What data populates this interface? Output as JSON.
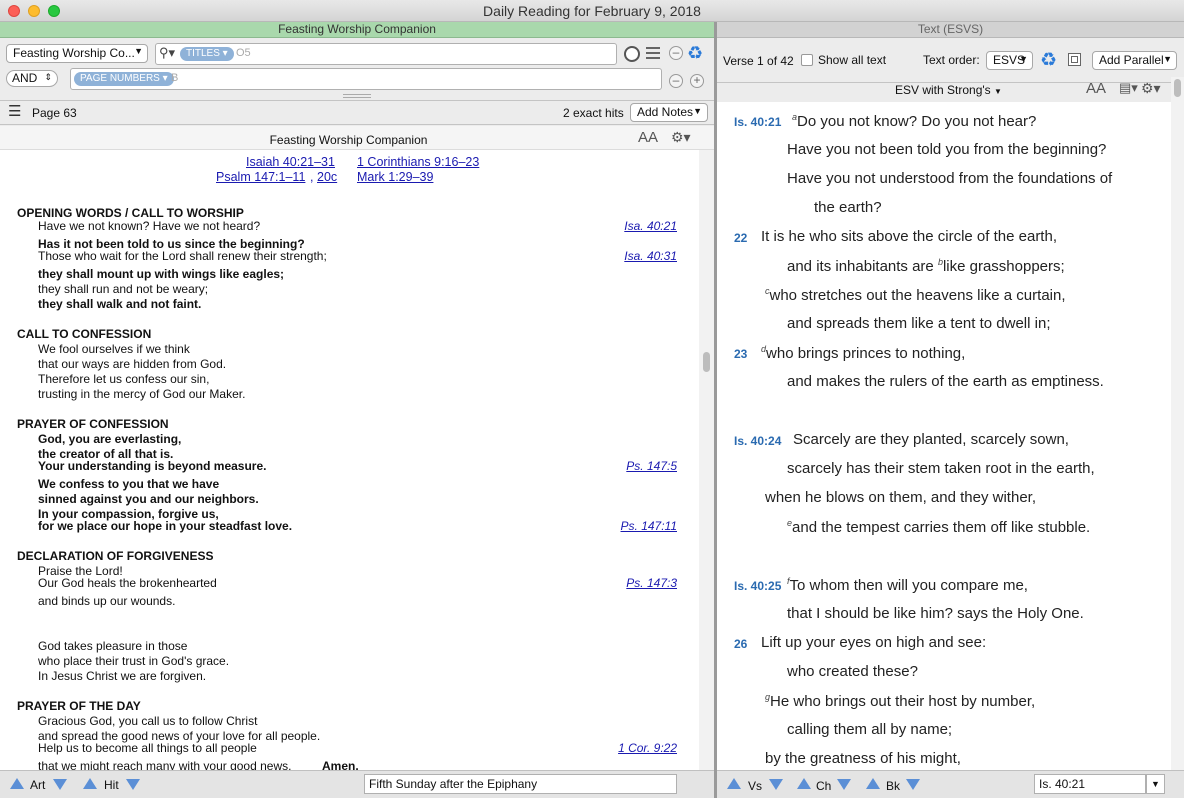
{
  "window": {
    "title": "Daily Reading for February 9, 2018"
  },
  "left": {
    "pane_title": "Feasting Worship Companion",
    "resource_select": "Feasting Worship Co...",
    "search": {
      "pill1": "TITLES",
      "value1": "O5",
      "bool_op": "AND",
      "pill2": "PAGE NUMBERS",
      "value2": "B"
    },
    "page_label": "Page 63",
    "hits": "2 exact hits",
    "add_notes": "Add Notes",
    "doc_title": "Feasting Worship Companion",
    "aa": "AA",
    "top_links": [
      "Isaiah 40:21–31",
      "1 Corinthians 9:16–23",
      "Psalm 147:1–11",
      "20c",
      "Mark 1:29–39"
    ],
    "lines": [
      {
        "t": "OPENING WORDS / CALL TO WORSHIP",
        "k": "hd"
      },
      {
        "t": "Have we not known? Have we not heard?",
        "k": "n",
        "ref": "Isa. 40:21"
      },
      {
        "t": "Has it not been told to us since the beginning?",
        "k": "b"
      },
      {
        "t": "Those who wait for the Lord shall renew their strength;",
        "k": "n",
        "ref": "Isa. 40:31"
      },
      {
        "t": "they shall mount up with wings like eagles;",
        "k": "b"
      },
      {
        "t": "they shall run and not be weary;",
        "k": "n"
      },
      {
        "t": "they shall walk and not faint.",
        "k": "b"
      },
      {
        "t": "CALL TO CONFESSION",
        "k": "hd"
      },
      {
        "t": "We fool ourselves if we think",
        "k": "n"
      },
      {
        "t": "that our ways are hidden from God.",
        "k": "n"
      },
      {
        "t": "Therefore let us confess our sin,",
        "k": "n"
      },
      {
        "t": "trusting in the mercy of God our Maker.",
        "k": "n"
      },
      {
        "t": "PRAYER OF CONFESSION",
        "k": "hd"
      },
      {
        "t": "God, you are everlasting,",
        "k": "b"
      },
      {
        "t": "the creator of all that is.",
        "k": "b"
      },
      {
        "t": "Your understanding is beyond measure.",
        "k": "b",
        "ref": "Ps. 147:5"
      },
      {
        "t": "We confess to you that we have",
        "k": "b"
      },
      {
        "t": "sinned against you and our neighbors.",
        "k": "b"
      },
      {
        "t": "In your compassion, forgive us,",
        "k": "b"
      },
      {
        "t": "for we place our hope in your steadfast love.",
        "k": "b",
        "ref": "Ps. 147:11"
      },
      {
        "t": "DECLARATION OF FORGIVENESS",
        "k": "hd"
      },
      {
        "t": "Praise the Lord!",
        "k": "n"
      },
      {
        "t": "Our God heals the brokenhearted",
        "k": "n",
        "ref": "Ps. 147:3"
      },
      {
        "t": "and binds up our wounds.",
        "k": "n"
      },
      {
        "t": "God takes pleasure in those",
        "k": "n"
      },
      {
        "t": "who place their trust in God's grace.",
        "k": "n"
      },
      {
        "t": "In Jesus Christ we are forgiven.",
        "k": "n"
      },
      {
        "t": "PRAYER OF THE DAY",
        "k": "hd"
      },
      {
        "t": "Gracious God, you call us to follow Christ",
        "k": "n"
      },
      {
        "t": "and spread the good news of your love for all people.",
        "k": "n"
      },
      {
        "t": "Help us to become all things to all people",
        "k": "n",
        "ref": "1 Cor. 9:22"
      },
      {
        "t": "that we might reach many with your good news.",
        "k": "n",
        "tail": "Amen."
      }
    ],
    "bottom": {
      "art": "Art",
      "hit": "Hit",
      "field": "Fifth Sunday after the Epiphany"
    }
  },
  "right": {
    "pane_title": "Text (ESVS)",
    "verse_count": "Verse 1 of 42",
    "show_all": "Show all text",
    "text_order_label": "Text order:",
    "text_order_value": "ESVS",
    "add_parallel": "Add Parallel",
    "version": "ESV with Strong's",
    "aa": "AA",
    "verses": [
      {
        "num": "Is. 40:21",
        "fn": "a",
        "t": "Do you not know? Do you not hear?"
      },
      {
        "t": "Have you not been told you from the beginning?"
      },
      {
        "t": "Have you not understood from the foundations of"
      },
      {
        "t": "the earth?"
      },
      {
        "num": "22",
        "t": "It is he who sits above the circle of the earth,"
      },
      {
        "t": "and its inhabitants are ",
        "fn2": "b",
        "t2": "like grasshoppers;"
      },
      {
        "fn": "c",
        "t": "who stretches out the heavens like a curtain,"
      },
      {
        "t": "and spreads them like a tent to dwell in;"
      },
      {
        "num": "23",
        "fn": "d",
        "t": "who brings princes to nothing,"
      },
      {
        "t": "and makes the rulers of the earth as emptiness."
      },
      {
        "num": "Is. 40:24",
        "t": "Scarcely are they planted, scarcely sown,"
      },
      {
        "t": "scarcely has their stem taken root in the earth,"
      },
      {
        "t": "when he blows on them, and they wither,"
      },
      {
        "fn": "e",
        "t": "and the tempest carries them off like stubble."
      },
      {
        "num": "Is. 40:25",
        "fn": "f",
        "t": "To whom then will you compare me,"
      },
      {
        "t": "that I should be like him? says the Holy One."
      },
      {
        "num": "26",
        "t": "Lift up your eyes on high and see:"
      },
      {
        "t": "who created these?"
      },
      {
        "fn": "g",
        "t": "He who brings out their host by number,"
      },
      {
        "t": "calling them all by name;"
      },
      {
        "t": "by the greatness of his might,"
      }
    ],
    "bottom": {
      "vs": "Vs",
      "ch": "Ch",
      "bk": "Bk",
      "ref": "Is. 40:21"
    }
  }
}
